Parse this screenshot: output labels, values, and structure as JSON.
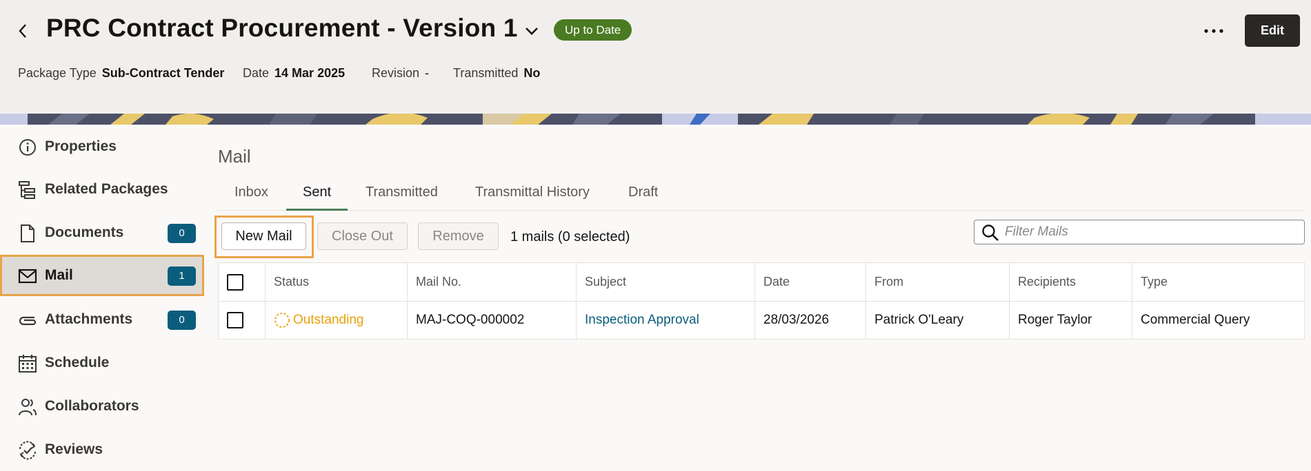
{
  "header": {
    "title": "PRC Contract Procurement - Version 1",
    "status": "Up to Date",
    "edit_label": "Edit",
    "meta": [
      {
        "label": "Package Type",
        "value": "Sub-Contract Tender"
      },
      {
        "label": "Date",
        "value": "14 Mar 2025"
      },
      {
        "label": "Revision",
        "value": "-"
      },
      {
        "label": "Transmitted",
        "value": "No"
      }
    ]
  },
  "sidebar": {
    "items": [
      {
        "label": "Properties",
        "icon": "info-icon"
      },
      {
        "label": "Related Packages",
        "icon": "hierarchy-icon"
      },
      {
        "label": "Documents",
        "icon": "document-icon",
        "badge": "0"
      },
      {
        "label": "Mail",
        "icon": "mail-icon",
        "badge": "1",
        "active": true
      },
      {
        "label": "Attachments",
        "icon": "paperclip-icon",
        "badge": "0"
      },
      {
        "label": "Schedule",
        "icon": "calendar-icon"
      },
      {
        "label": "Collaborators",
        "icon": "people-icon"
      },
      {
        "label": "Reviews",
        "icon": "review-icon"
      }
    ]
  },
  "main": {
    "title": "Mail",
    "tabs": [
      {
        "label": "Inbox"
      },
      {
        "label": "Sent",
        "active": true
      },
      {
        "label": "Transmitted"
      },
      {
        "label": "Transmittal History"
      },
      {
        "label": "Draft"
      }
    ],
    "toolbar": {
      "new_mail": "New Mail",
      "close_out": "Close Out",
      "remove": "Remove",
      "count": "1 mails (0 selected)",
      "filter_placeholder": "Filter Mails"
    },
    "table": {
      "columns": [
        "Status",
        "Mail No.",
        "Subject",
        "Date",
        "From",
        "Recipients",
        "Type"
      ],
      "rows": [
        {
          "status": "Outstanding",
          "mail_no": "MAJ-COQ-000002",
          "subject": "Inspection Approval",
          "date": "28/03/2026",
          "from": "Patrick O'Leary",
          "recipients": "Roger Taylor",
          "type": "Commercial Query"
        }
      ]
    }
  },
  "colors": {
    "accent_highlight": "#e8a449",
    "badge": "#0b5d7c",
    "status_ok": "#4a7a22",
    "status_outstanding": "#e8a10a",
    "tab_underline": "#4e7f58"
  }
}
